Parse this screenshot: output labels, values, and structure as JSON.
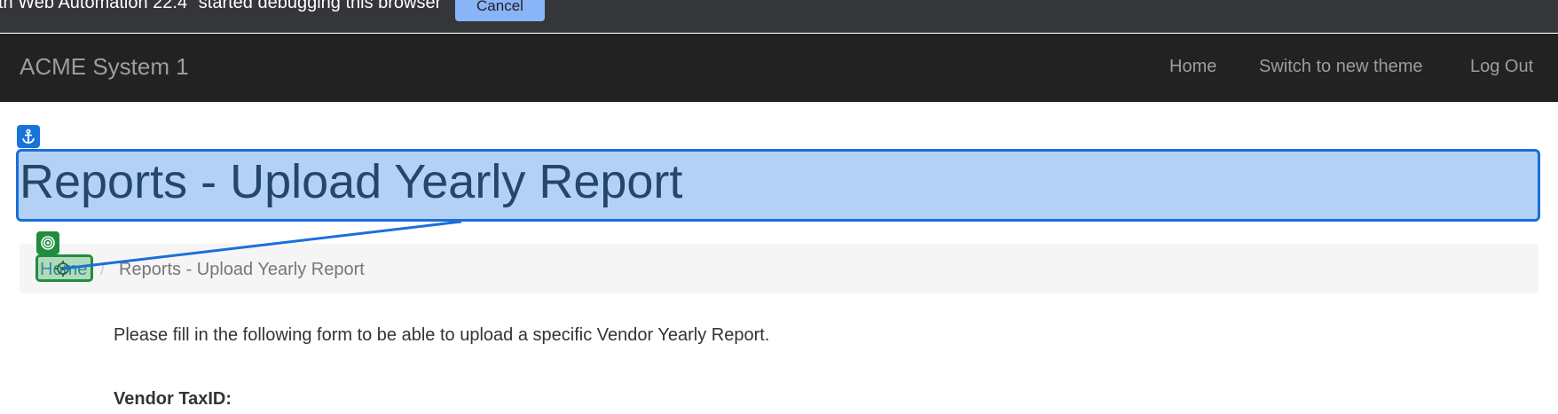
{
  "debug_banner": {
    "text": "th Web Automation 22.4\" started debugging this browser",
    "cancel_label": "Cancel"
  },
  "navbar": {
    "brand": "ACME System 1",
    "links": [
      "Home",
      "Switch to new theme",
      "Log Out"
    ]
  },
  "page": {
    "title": "Reports - Upload Yearly Report",
    "breadcrumb": {
      "home": "Home",
      "separator": "/",
      "current": "Reports - Upload Yearly Report"
    },
    "intro": "Please fill in the following form to be able to upload a specific Vendor Yearly Report.",
    "vendor_taxid_label": "Vendor TaxID:"
  },
  "overlay": {
    "anchor_icon": "anchor-icon",
    "target_icon": "target-icon",
    "anchor_color": "#1a73d9",
    "target_color": "#1e8e3e"
  }
}
